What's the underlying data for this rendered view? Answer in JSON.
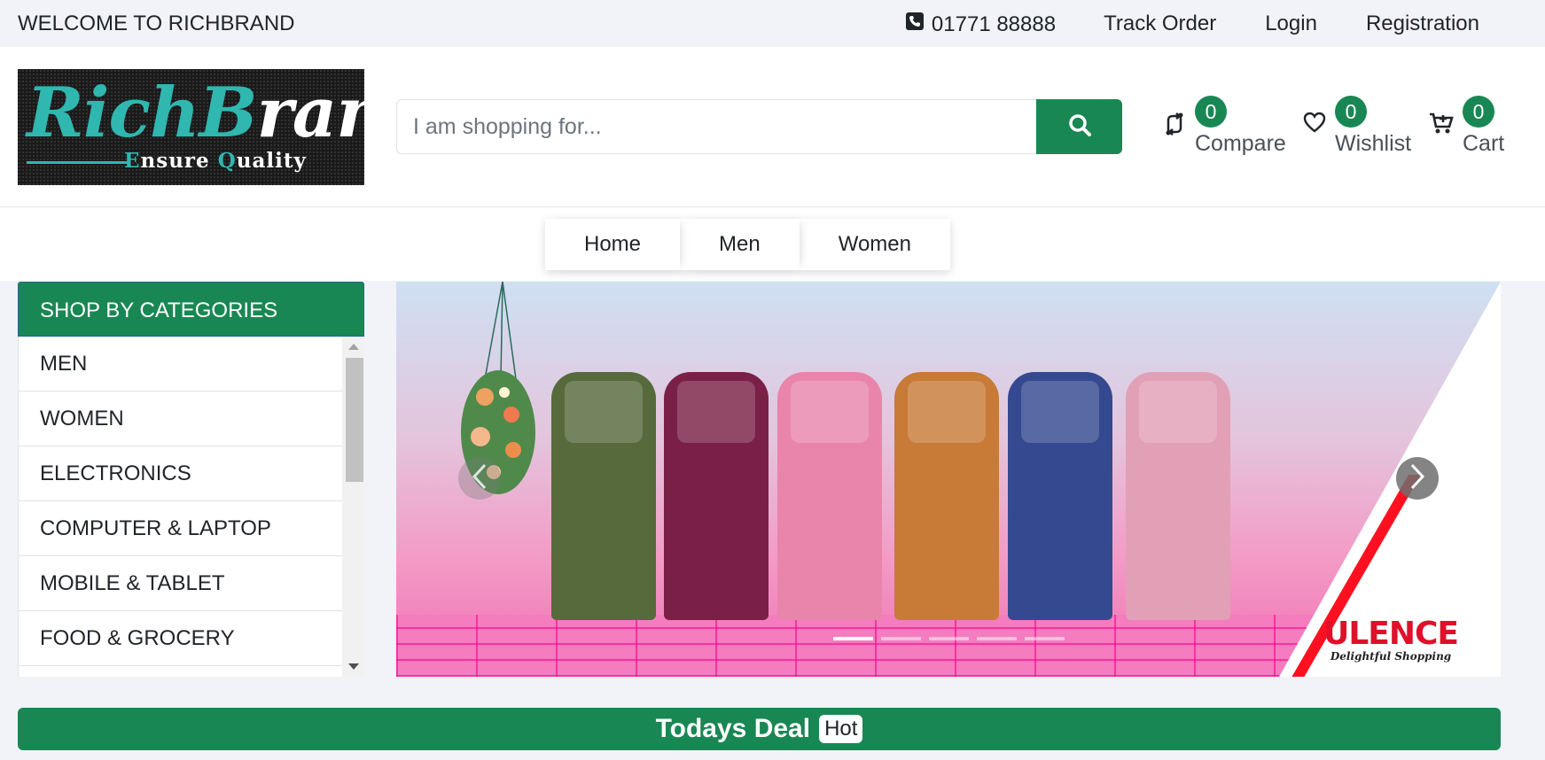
{
  "topbar": {
    "welcome": "WELCOME TO RICHBRAND",
    "phone": "01771 88888",
    "links": [
      "Track Order",
      "Login",
      "Registration"
    ]
  },
  "logo": {
    "text_part1": "Rich",
    "text_part2": "B",
    "text_part3": "rand",
    "tagline_part1": "E",
    "tagline_part2": "nsure ",
    "tagline_part3": "Q",
    "tagline_part4": "uality"
  },
  "search": {
    "placeholder": "I am shopping for..."
  },
  "header_icons": {
    "compare": {
      "count": "0",
      "label": "Compare"
    },
    "wishlist": {
      "count": "0",
      "label": "Wishlist"
    },
    "cart": {
      "count": "0",
      "label": "Cart"
    }
  },
  "nav": [
    "Home",
    "Men",
    "Women"
  ],
  "categories": {
    "title": "SHOP BY CATEGORIES",
    "items": [
      "MEN",
      "WOMEN",
      "ELECTRONICS",
      "COMPUTER & LAPTOP",
      "MOBILE & TABLET",
      "FOOD & GROCERY"
    ]
  },
  "slider": {
    "brand": "ULENCE",
    "brand_tagline": "Delightful Shopping",
    "dress_colors": [
      "#566a3c",
      "#7a2046",
      "#e985ab",
      "#c87a37",
      "#34498f",
      "#e2a0b6"
    ],
    "active_slide": 1,
    "slide_count": 5
  },
  "todays_deal": {
    "title": "Todays Deal",
    "badge": "Hot"
  },
  "colors": {
    "accent": "#198754"
  }
}
